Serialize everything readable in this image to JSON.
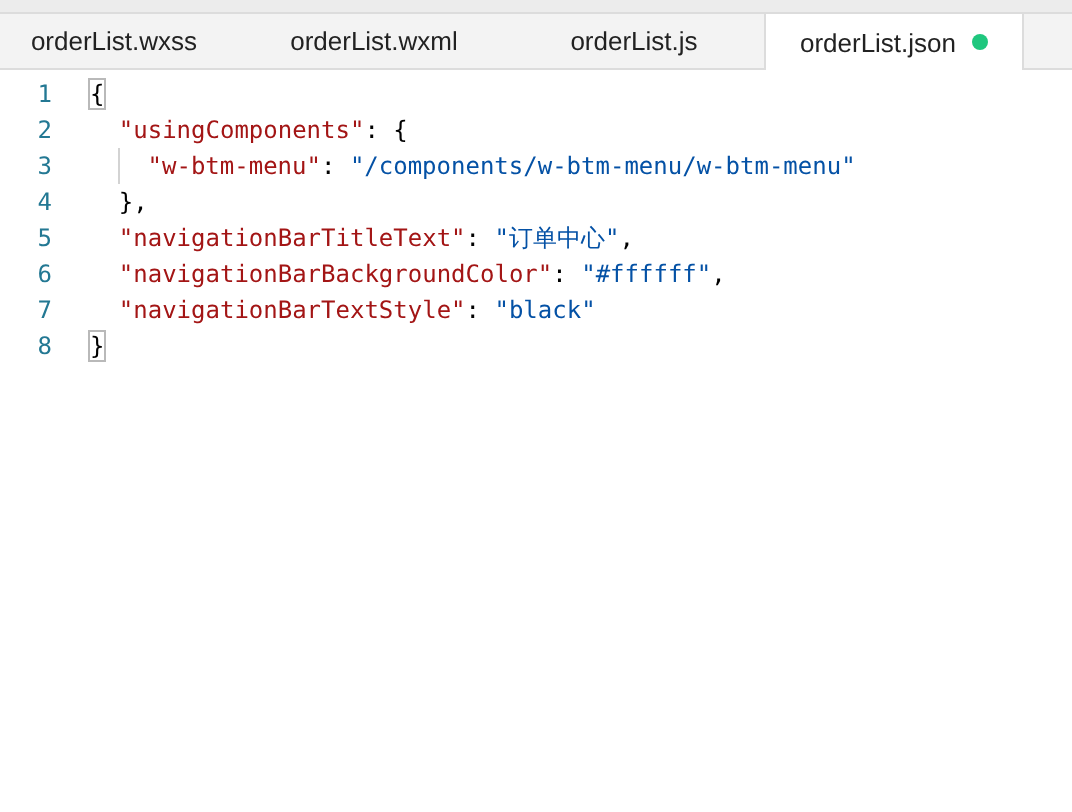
{
  "tabs": [
    {
      "label": "orderList.wxss",
      "selected": false,
      "modified": false
    },
    {
      "label": "orderList.wxml",
      "selected": false,
      "modified": false
    },
    {
      "label": "orderList.js",
      "selected": false,
      "modified": false
    },
    {
      "label": "orderList.json",
      "selected": true,
      "modified": true
    }
  ],
  "editor": {
    "lines": [
      {
        "number": "1",
        "tokens": [
          {
            "kind": "bracket",
            "text": "{"
          }
        ],
        "children": [
          {
            "number": "2",
            "tokens": [
              {
                "kind": "key",
                "text": "\"usingComponents\""
              },
              {
                "kind": "punct",
                "text": ": {"
              }
            ],
            "children": [
              {
                "number": "3",
                "tokens": [
                  {
                    "kind": "key",
                    "text": "\"w-btm-menu\""
                  },
                  {
                    "kind": "punct",
                    "text": ": "
                  },
                  {
                    "kind": "string",
                    "text": "\"/components/w-btm-menu/w-btm-menu\""
                  }
                ]
              }
            ]
          },
          {
            "number": "4",
            "tokens": [
              {
                "kind": "punct",
                "text": "},"
              }
            ]
          },
          {
            "number": "5",
            "tokens": [
              {
                "kind": "key",
                "text": "\"navigationBarTitleText\""
              },
              {
                "kind": "punct",
                "text": ": "
              },
              {
                "kind": "string",
                "text": "\"订单中心\""
              },
              {
                "kind": "punct",
                "text": ","
              }
            ]
          },
          {
            "number": "6",
            "tokens": [
              {
                "kind": "key",
                "text": "\"navigationBarBackgroundColor\""
              },
              {
                "kind": "punct",
                "text": ": "
              },
              {
                "kind": "string",
                "text": "\"#ffffff\""
              },
              {
                "kind": "punct",
                "text": ","
              }
            ]
          },
          {
            "number": "7",
            "tokens": [
              {
                "kind": "key",
                "text": "\"navigationBarTextStyle\""
              },
              {
                "kind": "punct",
                "text": ": "
              },
              {
                "kind": "string",
                "text": "\"black\""
              }
            ]
          }
        ]
      },
      {
        "number": "8",
        "tokens": [
          {
            "kind": "bracket",
            "text": "}"
          }
        ]
      }
    ]
  }
}
